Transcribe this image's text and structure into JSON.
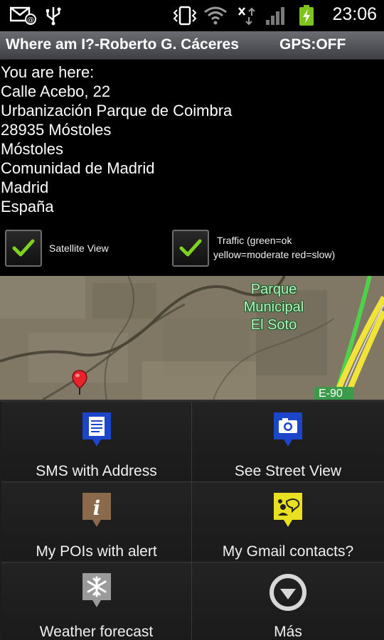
{
  "status_bar": {
    "time": "23:06",
    "icons": [
      "sms-notification-icon",
      "usb-icon",
      "vibrate-icon",
      "wifi-icon",
      "data-transfer-icon",
      "signal-icon",
      "battery-charging-icon"
    ]
  },
  "title_bar": {
    "app_title": "Where am I?-Roberto G. Cáceres",
    "gps_status": "GPS:OFF"
  },
  "address": {
    "lines": [
      "You are here:",
      "Calle Acebo, 22",
      "Urbanización Parque de Coimbra",
      "28935 Móstoles",
      "Móstoles",
      "Comunidad de Madrid",
      "Madrid",
      "España"
    ]
  },
  "options": {
    "satellite": {
      "label": "Satellite View",
      "checked": true
    },
    "traffic": {
      "label_line1": "Traffic (green=ok",
      "label_line2": "yellow=moderate red=slow)",
      "checked": true
    }
  },
  "map": {
    "park_label_lines": [
      "Parque",
      "Municipal",
      "El Soto"
    ],
    "road_label": "E-90"
  },
  "menu": [
    {
      "label": "SMS with Address",
      "icon": "sms-document-icon",
      "color": "#1b46c9"
    },
    {
      "label": "See Street View",
      "icon": "camera-icon",
      "color": "#1b46c9"
    },
    {
      "label": "My POIs with alert",
      "icon": "info-icon",
      "color": "#8a6a4a"
    },
    {
      "label": "My Gmail contacts?",
      "icon": "contacts-icon",
      "color": "#e8e020"
    },
    {
      "label": "Weather forecast",
      "icon": "snowflake-icon",
      "color": "#9a9a9a"
    },
    {
      "label": "Más",
      "icon": "more-icon",
      "color": "#ffffff"
    }
  ]
}
